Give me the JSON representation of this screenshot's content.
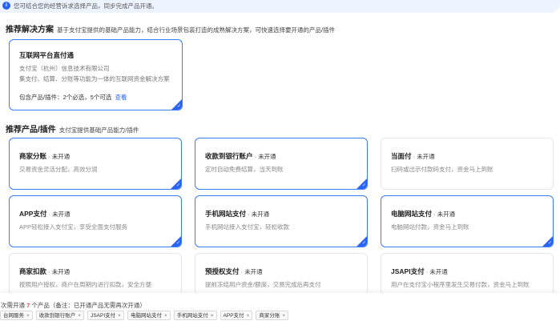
{
  "notice": {
    "text": "您可结合您的经营诉求选择产品，同步完成产品开通。"
  },
  "solutions": {
    "title": "推荐解决方案",
    "subtitle": "基于支付宝提供的基础产品能力，结合行业场景包装打造的成熟解决方案，可快速选择要开通的产品/插件",
    "card": {
      "name": "互联网平台直付通",
      "company": "支付宝（杭州）信息技术有限公司",
      "desc": "集支付、结算、分账等功能为一体的互联网资金解决方案",
      "include": "包含产品/插件：2个必选，5个可选",
      "link": "查看"
    }
  },
  "products": {
    "title": "推荐产品/插件",
    "subtitle": "支付宝提供基础产品能力/插件",
    "items": [
      {
        "name": "商家分账",
        "status": "未开通",
        "desc": "交易资金灵活分配，高效分润",
        "selected": true
      },
      {
        "name": "收款到银行账户",
        "status": "未开通",
        "desc": "定时自动免费结算，当天到账",
        "selected": true
      },
      {
        "name": "当面付",
        "status": "未开通",
        "desc": "扫码或出示付款码支付，资金马上到账",
        "selected": false
      },
      {
        "name": "APP支付",
        "status": "未开通",
        "desc": "APP轻松接入支付宝，享受全面支付服务",
        "selected": true
      },
      {
        "name": "手机网站支付",
        "status": "未开通",
        "desc": "手机网站接入支付宝，轻松收款",
        "selected": true
      },
      {
        "name": "电脑网站支付",
        "status": "未开通",
        "desc": "电脑网站付款，资金马上到账",
        "selected": true
      },
      {
        "name": "商家扣款",
        "status": "未开通",
        "desc": "按照用户授权，商户在周期内进行扣款，安全方便",
        "selected": false
      },
      {
        "name": "预授权支付",
        "status": "未开通",
        "desc": "提前冻结用户资金/额度，交易完成后再支付",
        "selected": false
      },
      {
        "name": "JSAPI支付",
        "status": "未开通",
        "desc": "用户在支付宝小程序里发生交易付款，资金马上到账",
        "selected": false
      }
    ]
  },
  "footer": {
    "prefix": "次需开通",
    "count": "7",
    "suffix": "个产品（备注：已开通产品无需再次开通）",
    "tags": [
      "台网服务",
      "收款到银行账户",
      "JSAPI支付",
      "电脑网站支付",
      "手机网站支付",
      "APP支付",
      "商家分账"
    ],
    "close_glyph": "×"
  }
}
